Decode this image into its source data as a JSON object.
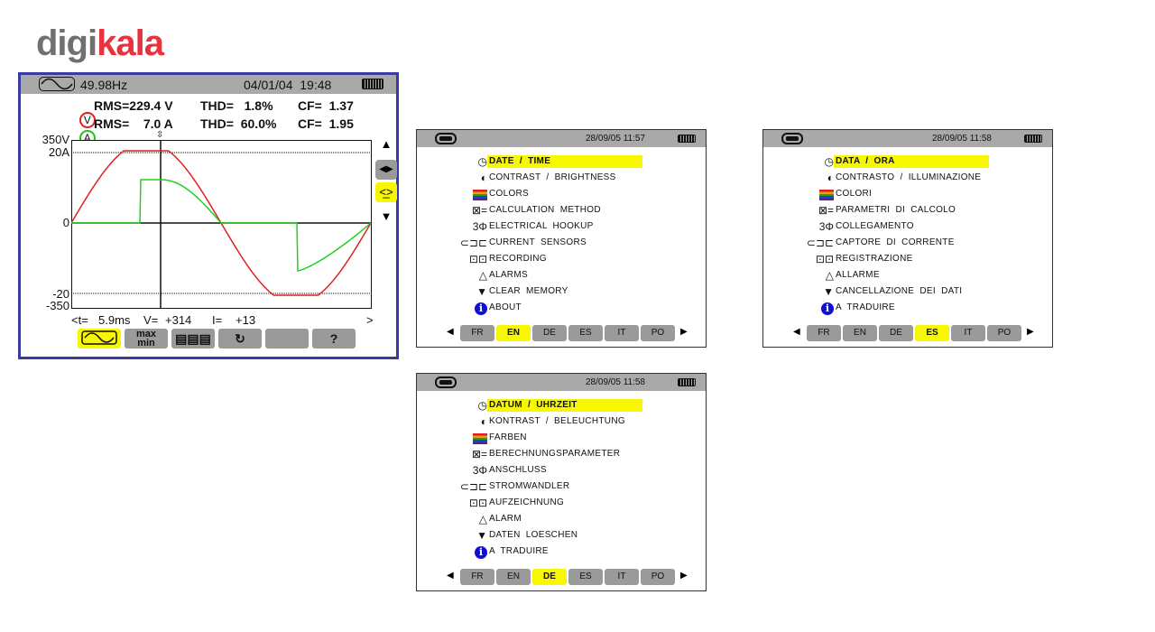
{
  "logo": {
    "text_a": "digi",
    "text_b": "kala"
  },
  "scope": {
    "frequency": "49.98Hz",
    "datetime": "04/01/04  19:48",
    "v": {
      "symbol": "V",
      "rms": "RMS=229.4 V",
      "thd": "THD=   1.8%",
      "cf": "CF=  1.37",
      "color": "#e02020"
    },
    "a": {
      "symbol": "A",
      "rms": "RMS=    7.0 A",
      "thd": "THD=  60.0%",
      "cf": "CF=  1.95",
      "color": "#20c020"
    },
    "y_labels": [
      "350V",
      "20A",
      "0",
      "-20",
      "-350"
    ],
    "cursor": {
      "t_label": "<t=",
      "t": "5.9ms",
      "v_label": "V=",
      "v": "+314",
      "i_label": "I=",
      "i": "+13",
      "right": ">"
    },
    "side": {
      "up": "▲",
      "lr": "◀▶",
      "zoom": "<̲>",
      "down": "▼"
    },
    "buttons": [
      {
        "icon": "waveform-icon",
        "active": true
      },
      {
        "label": "max\nmin"
      },
      {
        "icon": "table-icon",
        "label": "▤▤▤"
      },
      {
        "icon": "phase-rotation-icon",
        "label": "↻"
      },
      {
        "label": ""
      },
      {
        "label": "?"
      }
    ]
  },
  "panels": [
    {
      "time": "28/09/05 11:57",
      "selected_lang": 1,
      "items": [
        "DATE  /  TIME",
        "CONTRAST  /  BRIGHTNESS",
        "COLORS",
        "CALCULATION  METHOD",
        "ELECTRICAL  HOOKUP",
        "CURRENT  SENSORS",
        "RECORDING",
        "ALARMS",
        "CLEAR  MEMORY",
        "ABOUT"
      ]
    },
    {
      "time": "28/09/05 11:58",
      "selected_lang": 3,
      "items": [
        "DATA  /  ORA",
        "CONTRASTO  /  ILLUMINAZIONE",
        "COLORI",
        "PARAMETRI  DI  CALCOLO",
        "COLLEGAMENTO",
        "CAPTORE  DI  CORRENTE",
        "REGISTRAZIONE",
        "ALLARME",
        "CANCELLAZIONE  DEI  DATI",
        "A  TRADUIRE"
      ]
    },
    {
      "time": "28/09/05 11:58",
      "selected_lang": 2,
      "items": [
        "DATUM  /  UHRZEIT",
        "KONTRAST  /  BELEUCHTUNG",
        "FARBEN",
        "BERECHNUNGSPARAMETER",
        "ANSCHLUSS",
        "STROMWANDLER",
        "AUFZEICHNUNG",
        "ALARM",
        "DATEN  LOESCHEN",
        "A  TRADUIRE"
      ]
    }
  ],
  "languages": [
    "FR",
    "EN",
    "DE",
    "ES",
    "IT",
    "PO"
  ],
  "menu_icons": [
    {
      "name": "clock-icon",
      "glyph": "◷"
    },
    {
      "name": "contrast-icon",
      "glyph": "◐"
    },
    {
      "name": "colors-icon",
      "glyph": ""
    },
    {
      "name": "calculation-icon",
      "glyph": "⊠="
    },
    {
      "name": "three-phase-icon",
      "glyph": "3Φ"
    },
    {
      "name": "current-sensor-icon",
      "glyph": "⊂⊐⊏"
    },
    {
      "name": "recording-icon",
      "glyph": "⊡⊡"
    },
    {
      "name": "bell-icon",
      "glyph": "△"
    },
    {
      "name": "trash-icon",
      "glyph": "▼"
    },
    {
      "name": "info-icon",
      "glyph": "i"
    }
  ],
  "highlight_color": "#f7f700"
}
